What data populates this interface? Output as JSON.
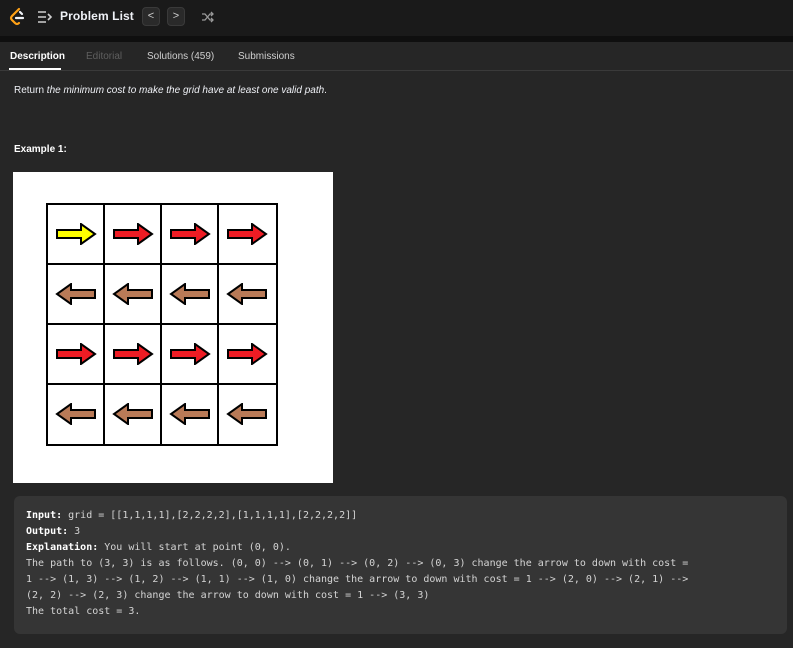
{
  "topbar": {
    "problem_list_label": "Problem List",
    "prev_label": "<",
    "next_label": ">"
  },
  "tabs": [
    {
      "label": "Description",
      "state": "active"
    },
    {
      "label": "Editorial",
      "state": "disabled"
    },
    {
      "label": "Solutions (459)",
      "state": "normal"
    },
    {
      "label": "Submissions",
      "state": "normal"
    }
  ],
  "description": {
    "prefix": "Return ",
    "italic": "the minimum cost to make the grid have at least one valid path",
    "suffix": "."
  },
  "example": {
    "title": "Example 1:",
    "grid_arrows": [
      [
        "right-yellow",
        "right-red",
        "right-red",
        "right-red"
      ],
      [
        "left-brown",
        "left-brown",
        "left-brown",
        "left-brown"
      ],
      [
        "right-red",
        "right-red",
        "right-red",
        "right-red"
      ],
      [
        "left-brown",
        "left-brown",
        "left-brown",
        "left-brown"
      ]
    ],
    "colors": {
      "yellow": "#ffff00",
      "red": "#ee1c24",
      "brown": "#b97a57"
    },
    "input_label": "Input:",
    "input_value": " grid = [[1,1,1,1],[2,2,2,2],[1,1,1,1],[2,2,2,2]]",
    "output_label": "Output:",
    "output_value": " 3",
    "explanation_label": "Explanation:",
    "explanation_value": " You will start at point (0, 0).",
    "line2": "The path to (3, 3) is as follows. (0, 0) --> (0, 1) --> (0, 2) --> (0, 3) change the arrow to down with cost =",
    "line3": "1 --> (1, 3) --> (1, 2) --> (1, 1) --> (1, 0) change the arrow to down with cost = 1 --> (2, 0) --> (2, 1) -->",
    "line4": "(2, 2) --> (2, 3) change the arrow to down with cost = 1 --> (3, 3)",
    "line5": "The total cost = 3."
  }
}
